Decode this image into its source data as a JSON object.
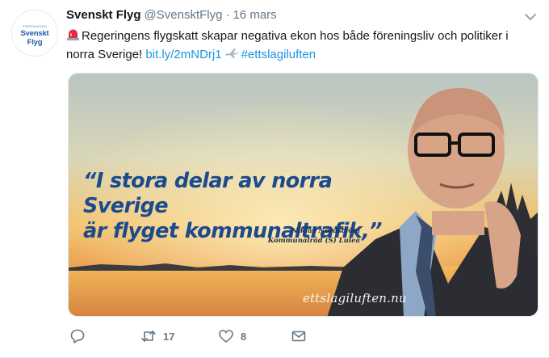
{
  "tweet": {
    "avatar": {
      "supertitle": "FÖRENINGEN",
      "name": "Svenskt Flyg"
    },
    "author_name": "Svenskt Flyg",
    "handle": "@SvensktFlyg",
    "separator": "·",
    "date": "16 mars",
    "text_main": "Regeringens flygskatt skapar negativa ekon hos både föreningsliv och politiker i norra Sverige!",
    "link": "bit.ly/2mNDrj1",
    "hashtag": "#ettslagiluften",
    "icons": [
      "rotating-light-emoji",
      "airplane-emoji",
      "chevron-down-icon",
      "reply-icon",
      "retweet-icon",
      "heart-icon",
      "envelope-icon"
    ],
    "media": {
      "quote_line1": "“I stora delar av norra Sverige",
      "quote_line2": "är flyget kommunaltrafik,”",
      "attribution_name": "Niklas Nordström",
      "attribution_role": "Kommunalråd (S) Luleå",
      "watermark": "ettslagiluften.nu"
    },
    "actions": {
      "retweets": "17",
      "likes": "8"
    }
  },
  "colors": {
    "link": "#1b95e0",
    "muted": "#657786",
    "quote": "#1c4a8e"
  }
}
